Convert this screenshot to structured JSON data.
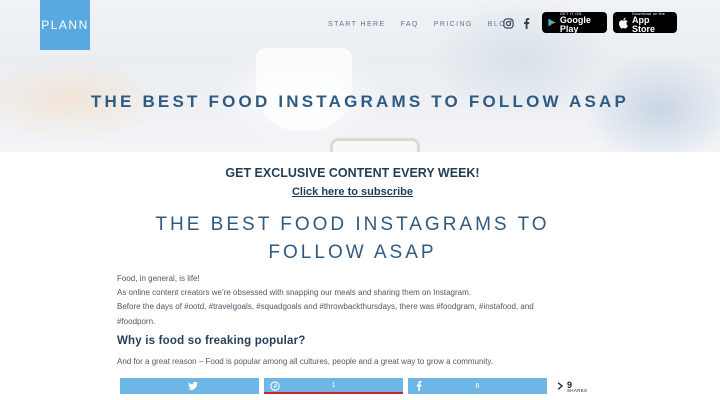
{
  "brand": {
    "logo_text": "PLANN",
    "color": "#5aa8e0"
  },
  "nav": {
    "items": [
      "START HERE",
      "FAQ",
      "PRICING",
      "BLOG"
    ],
    "social_icons": [
      "instagram-icon",
      "facebook-icon"
    ]
  },
  "stores": {
    "google": {
      "small": "GET IT ON",
      "big": "Google Play"
    },
    "apple": {
      "small": "Download on the",
      "big": "App Store"
    }
  },
  "hero": {
    "title": "THE BEST FOOD INSTAGRAMS TO FOLLOW ASAP"
  },
  "cta": {
    "headline": "GET EXCLUSIVE CONTENT EVERY WEEK!",
    "link": "Click here to subscribe"
  },
  "article": {
    "title_line1": "THE BEST FOOD INSTAGRAMS TO",
    "title_line2": "FOLLOW ASAP",
    "intro": [
      "Food, in general, is life!",
      "As online content creators we’re obsessed with snapping our meals and sharing them on Instagram.",
      "Before the days of #ootd, #travelgoals, #squadgoals and #throwbackthursdays, there was #foodgram, #instafood, and",
      "#foodporn."
    ],
    "section_heading": "Why is food so freaking popular?",
    "paragraph": "And for a great reason – Food is popular among all cultures, people and a great way to grow a community."
  },
  "share": {
    "twitter_count": "",
    "pinterest_count": "1",
    "facebook_count": "8",
    "total": "9",
    "total_label": "SHARES",
    "accent": "#6eb6e6",
    "pinterest_border": "#c8252c"
  }
}
